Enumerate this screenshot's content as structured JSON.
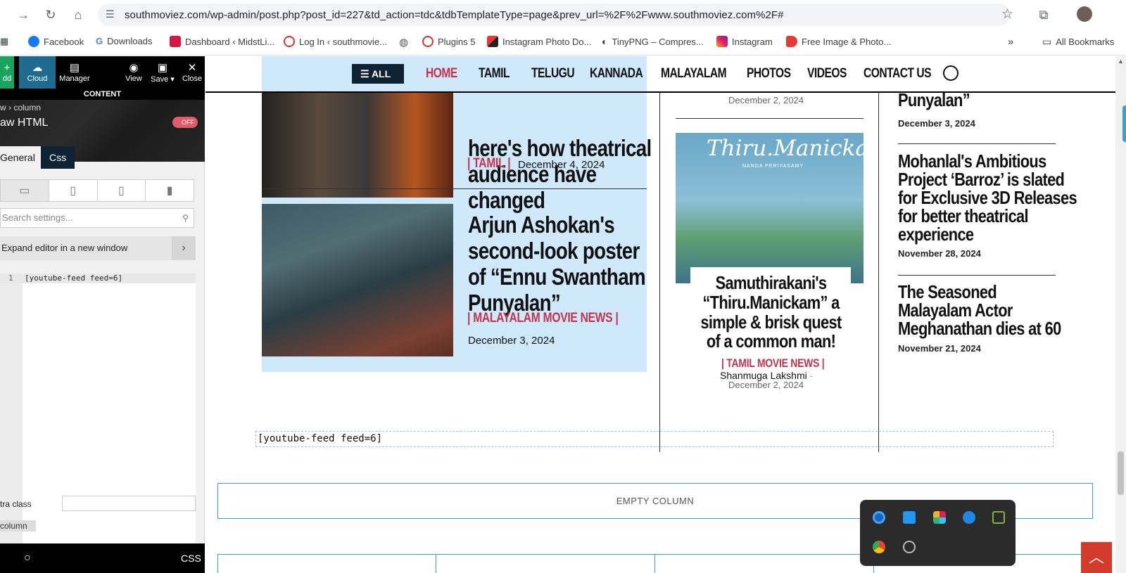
{
  "browser": {
    "url": "southmoviez.com/wp-admin/post.php?post_id=227&td_action=tdc&tdbTemplateType=page&prev_url=%2F%2Fwww.southmoviez.com%2F#",
    "bookmarks": [
      "Facebook",
      "Downloads",
      "Dashboard ‹ MidstLi...",
      "Log In ‹ southmovie...",
      "Plugins 5",
      "Instagram Photo Do...",
      "TinyPNG – Compres...",
      "Instagram",
      "Free Image & Photo..."
    ],
    "more": "»",
    "all_bookmarks": "All Bookmarks"
  },
  "editor": {
    "toolbar": {
      "add": "dd",
      "cloud": "Cloud",
      "manager": "Manager",
      "view": "View",
      "save": "Save",
      "close": "Close"
    },
    "content_label": "CONTENT",
    "breadcrumb": "w › column",
    "element_title": "aw HTML",
    "toggle": "OFF",
    "tabs": {
      "general": "General",
      "css": "Css"
    },
    "search_placeholder": "Search settings...",
    "expand_label": "Expand editor in a new window",
    "line_number": "1",
    "code": "[youtube-feed feed=6]",
    "extra_class": "tra class",
    "column_tag": "column",
    "bottom_css": "CSS"
  },
  "site": {
    "menu": {
      "all": "ALL",
      "items": [
        "HOME",
        "TAMIL",
        "TELUGU",
        "KANNADA",
        "MALAYALAM",
        "PHOTOS",
        "VIDEOS",
        "CONTACT US"
      ]
    },
    "main": {
      "post1": {
        "title_line1": "here's how theatrical",
        "title_line2": "audience have",
        "title_line3": "changed",
        "category": "| TAMIL |",
        "date": "December 4, 2024"
      },
      "post2": {
        "title_line1": "Arjun Ashokan's",
        "title_line2": "second-look poster",
        "title_line3": "of “Ennu Swantham",
        "title_line4": "Punyalan”",
        "category": "| MALAYALAM MOVIE NEWS |",
        "date": "December 3, 2024"
      }
    },
    "middle": {
      "top_date": "December 2, 2024",
      "poster_title": "Thiru.Manickam",
      "poster_sub": "NANDA PERIYASAMY",
      "title_line1": "Samuthirakani's",
      "title_line2": "“Thiru.Manickam” a",
      "title_line3": "simple & brisk quest",
      "title_line4": "of a common man!",
      "category": "| TAMIL MOVIE NEWS |",
      "author": "Shanmuga Lakshmi",
      "separator": "-",
      "date": "December 2, 2024"
    },
    "right": {
      "post1": {
        "title": "Punyalan”",
        "date": "December 3, 2024"
      },
      "post2": {
        "title_line1": "Mohanlal's Ambitious",
        "title_line2": "Project ‘Barroz’ is slated",
        "title_line3": "for Exclusive 3D Releases",
        "title_line4": "for better theatrical",
        "title_line5": "experience",
        "date": "November 28, 2024"
      },
      "post3": {
        "title_line1": "The Seasoned",
        "title_line2": "Malayalam Actor",
        "title_line3": "Meghanathan dies at 60",
        "date": "November 21, 2024"
      }
    },
    "shortcode": "[youtube-feed feed=6]",
    "empty_column": "EMPTY COLUMN"
  },
  "colors": {
    "accent_red": "#c0344e",
    "nav_dark": "#0f2233",
    "light_blue": "#cfe8fa",
    "builder_blue": "#3aa0d8"
  }
}
